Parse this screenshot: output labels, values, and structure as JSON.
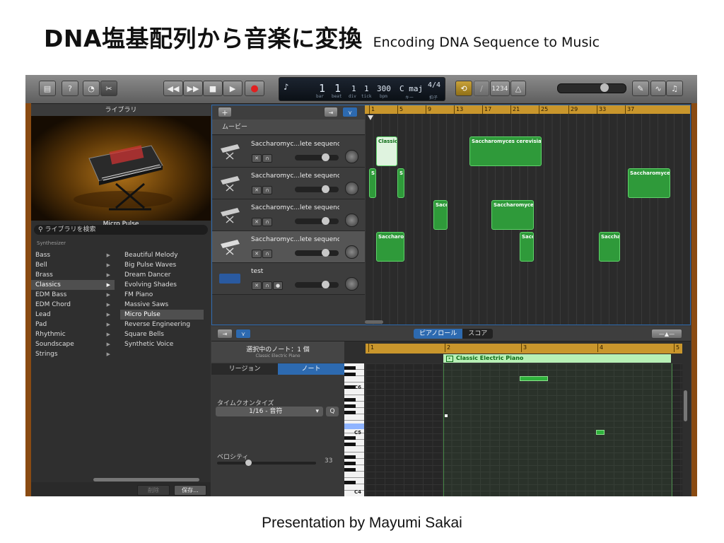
{
  "slide": {
    "title_jp": "DNA塩基配列から音楽に変換",
    "title_en": "Encoding DNA Sequence to Music",
    "footer": "Presentation by Mayumi Sakai"
  },
  "lcd": {
    "bar": "1",
    "beat": "1",
    "div": "1",
    "tick": "1",
    "tempo": "300",
    "key": "C maj",
    "time_sig": "4/4",
    "labels": {
      "bar": "bar",
      "beat": "beat",
      "div": "div",
      "tick": "tick",
      "tempo": "bpm",
      "key": "キー",
      "sig": "拍子"
    }
  },
  "transport": {
    "rewind": "◀◀",
    "forward": "▶▶",
    "stop": "■",
    "play": "▶",
    "record": "●"
  },
  "count_in": "1234",
  "library": {
    "header": "ライブラリ",
    "instrument": "Micro Pulse",
    "search_placeholder": "ライブラリを検索",
    "breadcrumb": "Synthesizer",
    "categories": [
      "Bass",
      "Bell",
      "Brass",
      "Classics",
      "EDM Bass",
      "EDM Chord",
      "Lead",
      "Pad",
      "Rhythmic",
      "Soundscape",
      "Strings"
    ],
    "selected_category": "Classics",
    "patches": [
      "Beautiful Melody",
      "Big Pulse Waves",
      "Dream Dancer",
      "Evolving Shades",
      "FM Piano",
      "Massive Saws",
      "Micro Pulse",
      "Reverse Engineering",
      "Square Bells",
      "Synthetic Voice"
    ],
    "selected_patch": "Micro Pulse",
    "delete_label": "削除",
    "save_label": "保存..."
  },
  "tracks_area": {
    "add_label": "+",
    "movie_label": "ムービー",
    "ruler": [
      "1",
      "5",
      "9",
      "13",
      "17",
      "21",
      "25",
      "29",
      "33",
      "37"
    ],
    "tracks": [
      {
        "name": "Saccharomyc...lete sequence",
        "selected": false,
        "volume": 0.72
      },
      {
        "name": "Saccharomyc...lete sequence",
        "selected": false,
        "volume": 0.72
      },
      {
        "name": "Saccharomyc...lete sequence",
        "selected": false,
        "volume": 0.72
      },
      {
        "name": "Saccharomyc...lete sequence",
        "selected": true,
        "volume": 0.72
      },
      {
        "name": "test",
        "selected": false,
        "volume": 0.72
      }
    ],
    "regions": {
      "classic": "Classic",
      "yeast_long": "Saccharomyces cerevisiae S",
      "yeast": "Saccharomyces",
      "yeast_short": "Saccharon",
      "yeast_shorter": "Saccha",
      "sacc": "Sacc",
      "s": "S"
    }
  },
  "editor": {
    "tabs": [
      "ピアノロール",
      "スコア"
    ],
    "active_tab": "ピアノロール",
    "selected_info": "選択中のノート：1 個",
    "selected_sub": "Classic Electric Piano",
    "inspector_tabs": [
      "リージョン",
      "ノート"
    ],
    "active_inspector_tab": "ノート",
    "quantize_label": "タイムクオンタイズ",
    "quantize_value": "1/16 - 音符",
    "quantize_button": "Q",
    "velocity_label": "ベロシティ",
    "velocity_value": "33",
    "velocity_level": 0.33,
    "ruler": [
      "1",
      "2",
      "3",
      "4",
      "5"
    ],
    "region_name": "Classic Electric Piano",
    "key_labels": [
      "C6",
      "C5",
      "C4"
    ]
  },
  "colors": {
    "region_green": "#2f9a3a",
    "ruler_gold": "#c9962c",
    "select_blue": "#2d6ab0",
    "wood": "#8a4b12"
  }
}
